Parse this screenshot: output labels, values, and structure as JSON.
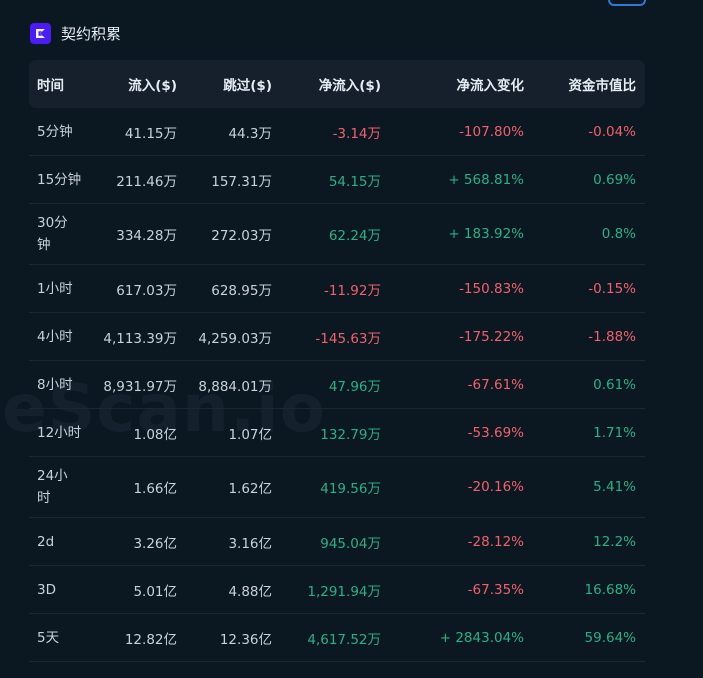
{
  "header": {
    "title": "契约积累",
    "logo_icon": "brand-logo-icon",
    "accent": "#4b1cf5"
  },
  "watermark": "eScan.io",
  "colors": {
    "positive": "#26b382",
    "negative": "#f0616d",
    "background": "#0b1721"
  },
  "table": {
    "columns": [
      "时间",
      "流入($)",
      "跳过($)",
      "净流入($)",
      "净流入变化",
      "资金市值比"
    ],
    "rows": [
      {
        "time": "5分钟",
        "inflow": "41.15万",
        "outflow": "44.3万",
        "net": "-3.14万",
        "net_sign": "neg",
        "change": "-107.80%",
        "change_sign": "neg",
        "ratio": "-0.04%",
        "ratio_sign": "neg"
      },
      {
        "time": "15分钟",
        "inflow": "211.46万",
        "outflow": "157.31万",
        "net": "54.15万",
        "net_sign": "pos",
        "change": "+ 568.81%",
        "change_sign": "pos",
        "ratio": "0.69%",
        "ratio_sign": "pos"
      },
      {
        "time": "30分\n钟",
        "inflow": "334.28万",
        "outflow": "272.03万",
        "net": "62.24万",
        "net_sign": "pos",
        "change": "+ 183.92%",
        "change_sign": "pos",
        "ratio": "0.8%",
        "ratio_sign": "pos"
      },
      {
        "time": "1小时",
        "inflow": "617.03万",
        "outflow": "628.95万",
        "net": "-11.92万",
        "net_sign": "neg",
        "change": "-150.83%",
        "change_sign": "neg",
        "ratio": "-0.15%",
        "ratio_sign": "neg"
      },
      {
        "time": "4小时",
        "inflow": "4,113.39万",
        "outflow": "4,259.03万",
        "net": "-145.63万",
        "net_sign": "neg",
        "change": "-175.22%",
        "change_sign": "neg",
        "ratio": "-1.88%",
        "ratio_sign": "neg"
      },
      {
        "time": "8小时",
        "inflow": "8,931.97万",
        "outflow": "8,884.01万",
        "net": "47.96万",
        "net_sign": "pos",
        "change": "-67.61%",
        "change_sign": "neg",
        "ratio": "0.61%",
        "ratio_sign": "pos"
      },
      {
        "time": "12小时",
        "inflow": "1.08亿",
        "outflow": "1.07亿",
        "net": "132.79万",
        "net_sign": "pos",
        "change": "-53.69%",
        "change_sign": "neg",
        "ratio": "1.71%",
        "ratio_sign": "pos"
      },
      {
        "time": "24小\n时",
        "inflow": "1.66亿",
        "outflow": "1.62亿",
        "net": "419.56万",
        "net_sign": "pos",
        "change": "-20.16%",
        "change_sign": "neg",
        "ratio": "5.41%",
        "ratio_sign": "pos"
      },
      {
        "time": "2d",
        "inflow": "3.26亿",
        "outflow": "3.16亿",
        "net": "945.04万",
        "net_sign": "pos",
        "change": "-28.12%",
        "change_sign": "neg",
        "ratio": "12.2%",
        "ratio_sign": "pos"
      },
      {
        "time": "3D",
        "inflow": "5.01亿",
        "outflow": "4.88亿",
        "net": "1,291.94万",
        "net_sign": "pos",
        "change": "-67.35%",
        "change_sign": "neg",
        "ratio": "16.68%",
        "ratio_sign": "pos"
      },
      {
        "time": "5天",
        "inflow": "12.82亿",
        "outflow": "12.36亿",
        "net": "4,617.52万",
        "net_sign": "pos",
        "change": "+ 2843.04%",
        "change_sign": "pos",
        "ratio": "59.64%",
        "ratio_sign": "pos"
      }
    ]
  }
}
